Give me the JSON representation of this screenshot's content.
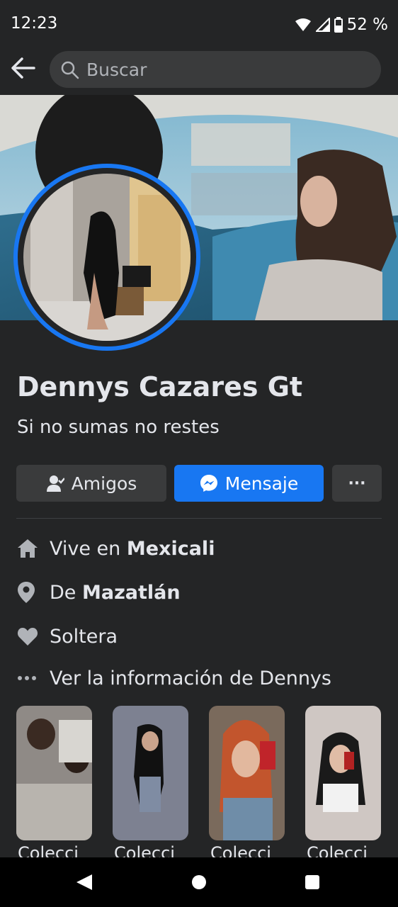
{
  "status_bar": {
    "time": "12:23",
    "battery": "52 %"
  },
  "search": {
    "placeholder": "Buscar"
  },
  "profile": {
    "name": "Dennys Cazares Gt",
    "bio": "Si no sumas no restes"
  },
  "actions": {
    "friends": "Amigos",
    "message": "Mensaje",
    "more": "···"
  },
  "info": {
    "lives_prefix": "Vive en ",
    "lives_city": "Mexicali",
    "from_prefix": "De ",
    "from_city": "Mazatlán",
    "relationship": "Soltera",
    "see_more": "Ver la información de Dennys"
  },
  "collections": [
    {
      "label": "Colecci"
    },
    {
      "label": "Colecci"
    },
    {
      "label": "Colecci"
    },
    {
      "label": "Colecci"
    }
  ],
  "colors": {
    "accent": "#1877f2",
    "background": "#242526",
    "surface": "#3a3b3c"
  },
  "icons": [
    "back-arrow-icon",
    "search-icon",
    "wifi-icon",
    "signal-icon",
    "battery-icon",
    "add-friend-icon",
    "messenger-icon",
    "home-icon",
    "location-pin-icon",
    "heart-icon",
    "more-dots-icon",
    "nav-back-icon",
    "nav-home-icon",
    "nav-recents-icon"
  ]
}
